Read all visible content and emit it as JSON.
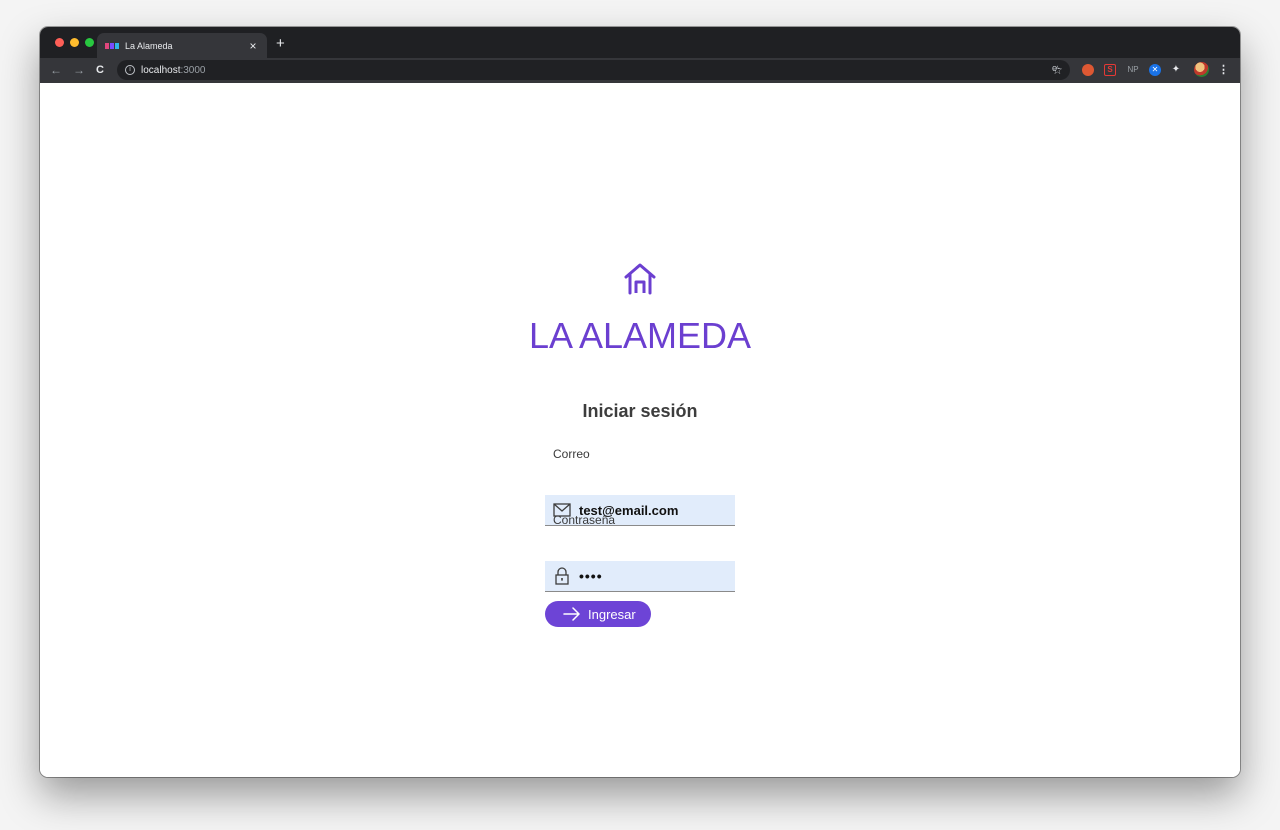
{
  "browser": {
    "tab_title": "La Alameda",
    "tab_close": "×",
    "new_tab": "+",
    "url_host": "localhost",
    "url_port": ":3000",
    "extensions": {
      "s_label": "S",
      "np_label": "NP"
    }
  },
  "page": {
    "brand": "LA ALAMEDA",
    "heading": "Iniciar sesión",
    "email": {
      "label": "Correo",
      "value": "test@email.com",
      "icon": "mail-icon"
    },
    "password": {
      "label": "Contraseña",
      "value": "••••",
      "icon": "lock-icon"
    },
    "submit_label": "Ingresar"
  },
  "colors": {
    "brand": "#6b3fd0",
    "button": "#6d44d6",
    "input_bg": "#e1ecfb",
    "chrome_dark": "#1f2023",
    "chrome_toolbar": "#35363a"
  }
}
